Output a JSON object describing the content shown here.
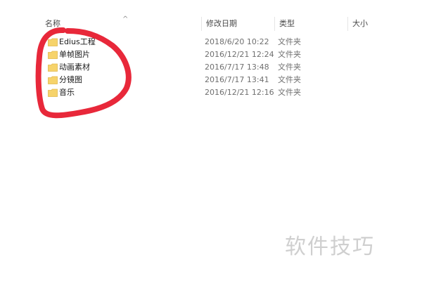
{
  "columns": {
    "name": "名称",
    "date": "修改日期",
    "type": "类型",
    "size": "大小"
  },
  "sort_indicator": "^",
  "files": [
    {
      "name": "Edius工程",
      "date": "2018/6/20 10:22",
      "type": "文件夹",
      "icon": "folder-icon"
    },
    {
      "name": "单帧图片",
      "date": "2016/12/21 12:24",
      "type": "文件夹",
      "icon": "folder-icon"
    },
    {
      "name": "动画素材",
      "date": "2016/7/17 13:48",
      "type": "文件夹",
      "icon": "folder-icon"
    },
    {
      "name": "分镜图",
      "date": "2016/7/17 13:41",
      "type": "文件夹",
      "icon": "folder-icon"
    },
    {
      "name": "音乐",
      "date": "2016/12/21 12:16",
      "type": "文件夹",
      "icon": "folder-icon"
    }
  ],
  "annotation_color": "#e8283a",
  "folder_color": "#f6d36b",
  "watermark": "软件技巧"
}
